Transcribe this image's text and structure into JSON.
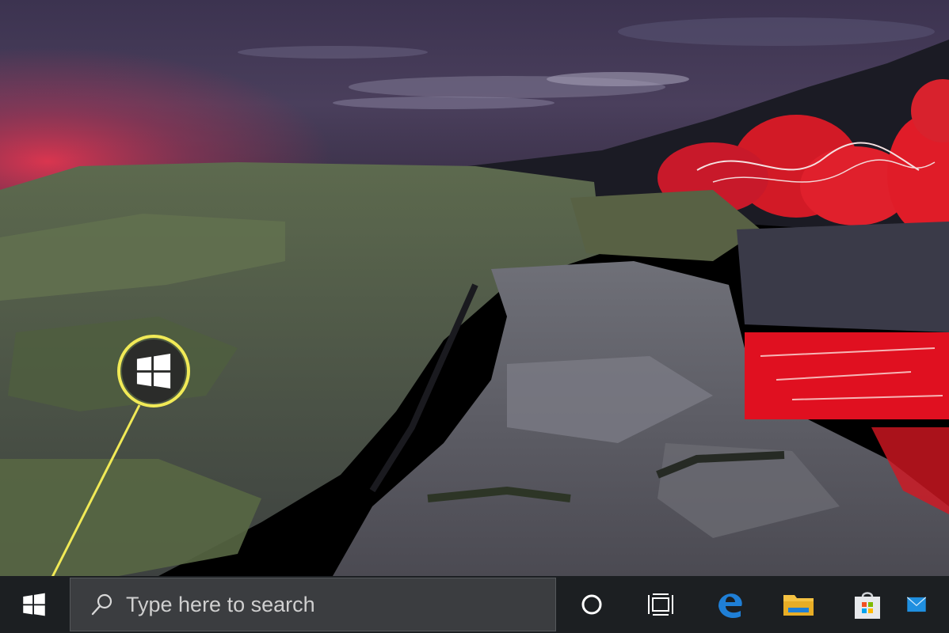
{
  "taskbar": {
    "start_button": "windows-start",
    "search": {
      "placeholder": "Type here to search",
      "icon": "search-icon"
    },
    "icons": [
      "cortana-icon",
      "task-view-icon",
      "edge-browser-icon",
      "file-explorer-icon",
      "store-icon",
      "mail-icon"
    ]
  },
  "callout": {
    "badge_icon": "windows-logo-icon",
    "accent_color": "#f1ea57"
  },
  "colors": {
    "taskbar_bg": "#1c1f22",
    "search_bg": "#3b3d40",
    "edge_blue": "#1f7fd6",
    "folder_yellow": "#f5c242"
  }
}
